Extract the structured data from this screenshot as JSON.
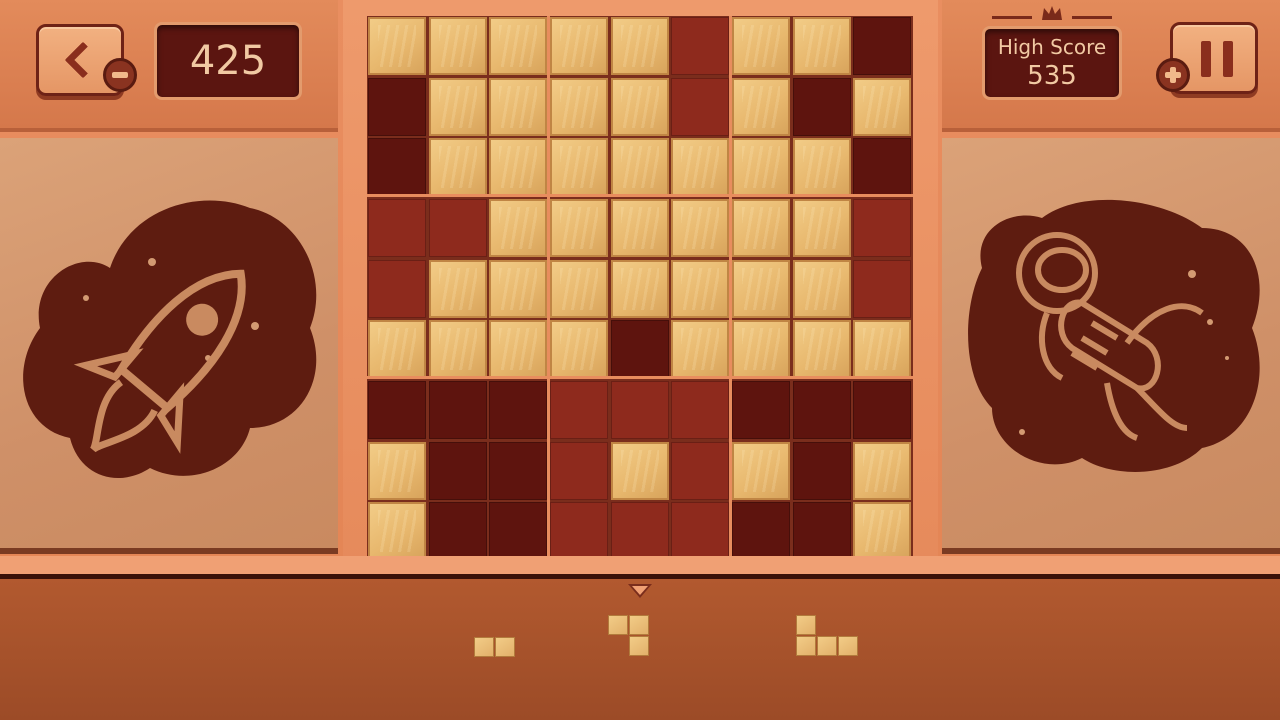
{
  "header": {
    "score": "425",
    "high_score_label": "High Score",
    "high_score_value": "535"
  },
  "buttons": {
    "back": "back",
    "pause": "pause"
  },
  "icons": {
    "back": "chevron-left-icon",
    "pause": "pause-icon",
    "minus_badge": "minus-icon",
    "plus_badge": "plus-icon",
    "crown": "crown-icon",
    "left_art": "rocket-icon",
    "right_art": "astronaut-icon"
  },
  "colors": {
    "board_background": "#e88d5e",
    "wood_block": "#ecbf78",
    "empty_cell_dark": "#5e140e",
    "empty_cell_red": "#8e2a1d",
    "tray": "#a9542c"
  },
  "board": {
    "size": 9,
    "filled_rows": [
      [
        1,
        1,
        1,
        1,
        1,
        0,
        1,
        1,
        0
      ],
      [
        0,
        1,
        1,
        1,
        1,
        0,
        1,
        0,
        1
      ],
      [
        0,
        1,
        1,
        1,
        1,
        1,
        1,
        1,
        0
      ],
      [
        0,
        0,
        1,
        1,
        1,
        1,
        1,
        1,
        0
      ],
      [
        0,
        1,
        1,
        1,
        1,
        1,
        1,
        1,
        0
      ],
      [
        1,
        1,
        1,
        1,
        0,
        1,
        1,
        1,
        1
      ],
      [
        0,
        0,
        0,
        0,
        0,
        0,
        0,
        0,
        0
      ],
      [
        1,
        0,
        0,
        0,
        1,
        0,
        1,
        0,
        1
      ],
      [
        1,
        0,
        0,
        0,
        0,
        0,
        0,
        0,
        1
      ]
    ]
  },
  "tray": {
    "selected_index": 1,
    "pieces": [
      {
        "name": "piece-horizontal-2",
        "cells": [
          [
            0,
            0
          ],
          [
            0,
            1
          ]
        ]
      },
      {
        "name": "piece-s-shape",
        "cells": [
          [
            0,
            0
          ],
          [
            0,
            1
          ],
          [
            1,
            1
          ]
        ]
      },
      {
        "name": "piece-l-shape",
        "cells": [
          [
            0,
            0
          ],
          [
            1,
            0
          ],
          [
            1,
            1
          ],
          [
            1,
            2
          ]
        ]
      }
    ]
  }
}
